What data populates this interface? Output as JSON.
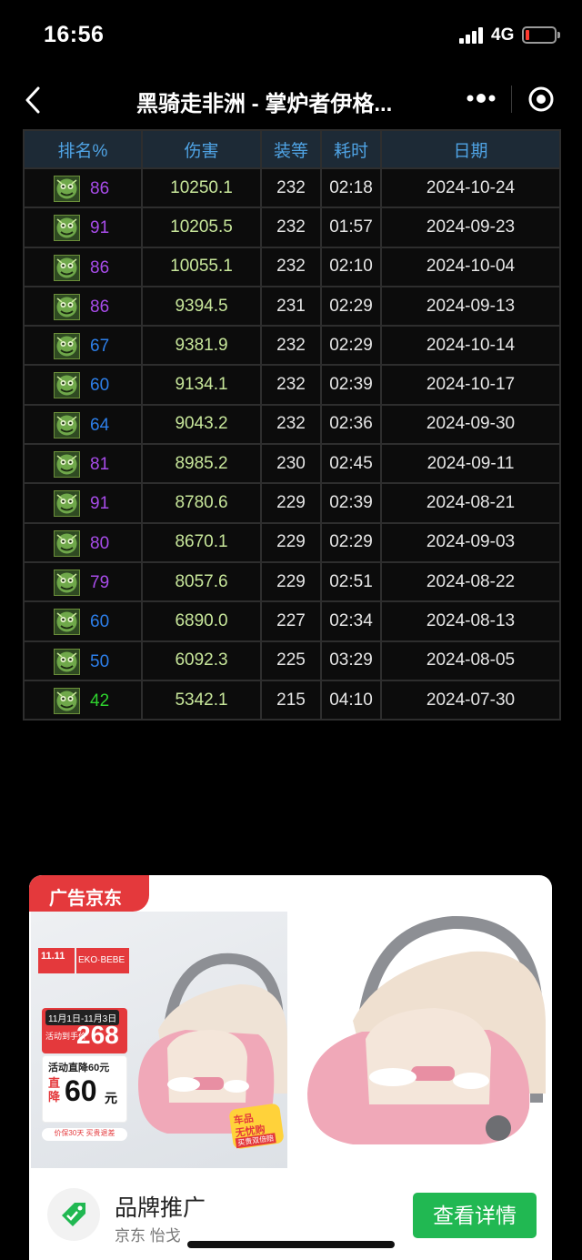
{
  "status_bar": {
    "time": "16:56",
    "network": "4G"
  },
  "nav": {
    "title": "黑骑走非洲 - 掌炉者伊格..."
  },
  "table": {
    "headers": [
      "排名%",
      "伤害",
      "装等",
      "耗时",
      "日期"
    ],
    "rows": [
      {
        "rank": "86",
        "tier": "epic",
        "damage": "10250.1",
        "ilvl": "232",
        "time": "02:18",
        "date": "2024-10-24"
      },
      {
        "rank": "91",
        "tier": "epic",
        "damage": "10205.5",
        "ilvl": "232",
        "time": "01:57",
        "date": "2024-09-23"
      },
      {
        "rank": "86",
        "tier": "epic",
        "damage": "10055.1",
        "ilvl": "232",
        "time": "02:10",
        "date": "2024-10-04"
      },
      {
        "rank": "86",
        "tier": "epic",
        "damage": "9394.5",
        "ilvl": "231",
        "time": "02:29",
        "date": "2024-09-13"
      },
      {
        "rank": "67",
        "tier": "rare",
        "damage": "9381.9",
        "ilvl": "232",
        "time": "02:29",
        "date": "2024-10-14"
      },
      {
        "rank": "60",
        "tier": "rare",
        "damage": "9134.1",
        "ilvl": "232",
        "time": "02:39",
        "date": "2024-10-17"
      },
      {
        "rank": "64",
        "tier": "rare",
        "damage": "9043.2",
        "ilvl": "232",
        "time": "02:36",
        "date": "2024-09-30"
      },
      {
        "rank": "81",
        "tier": "epic",
        "damage": "8985.2",
        "ilvl": "230",
        "time": "02:45",
        "date": "2024-09-11"
      },
      {
        "rank": "91",
        "tier": "epic",
        "damage": "8780.6",
        "ilvl": "229",
        "time": "02:39",
        "date": "2024-08-21"
      },
      {
        "rank": "80",
        "tier": "epic",
        "damage": "8670.1",
        "ilvl": "229",
        "time": "02:29",
        "date": "2024-09-03"
      },
      {
        "rank": "79",
        "tier": "epic",
        "damage": "8057.6",
        "ilvl": "229",
        "time": "02:51",
        "date": "2024-08-22"
      },
      {
        "rank": "60",
        "tier": "rare",
        "damage": "6890.0",
        "ilvl": "227",
        "time": "02:34",
        "date": "2024-08-13"
      },
      {
        "rank": "50",
        "tier": "rare",
        "damage": "6092.3",
        "ilvl": "225",
        "time": "03:29",
        "date": "2024-08-05"
      },
      {
        "rank": "42",
        "tier": "uncommon",
        "damage": "5342.1",
        "ilvl": "215",
        "time": "04:10",
        "date": "2024-07-30"
      }
    ]
  },
  "ad": {
    "tag": "广告京东",
    "promo_logo_left": "11.11",
    "promo_logo_right": "EKO·BEBE",
    "promo_dates": "11月1日-11月3日",
    "promo_price_label": "活动到手价",
    "promo_price": "268",
    "promo_drop_label": "活动直降60元",
    "promo_drop_prefix": "直降",
    "promo_drop_amount": "60",
    "promo_drop_unit": "元",
    "promo_footer": "价保30天 买贵退差",
    "promo_badge_1": "车品",
    "promo_badge_2": "无忧购",
    "promo_badge_3": "买贵双倍赔",
    "brand_name": "品牌推广",
    "brand_sub": "京东 怡戈",
    "detail_button": "查看详情"
  },
  "colors": {
    "header_bg": "#1d2a36",
    "header_text": "#4fa3e4",
    "damage_text": "#c7e69a",
    "epic": "#a84cea",
    "rare": "#2d7fea",
    "uncommon": "#2ed12e",
    "ad_red": "#e4393c",
    "button_green": "#21b852"
  }
}
